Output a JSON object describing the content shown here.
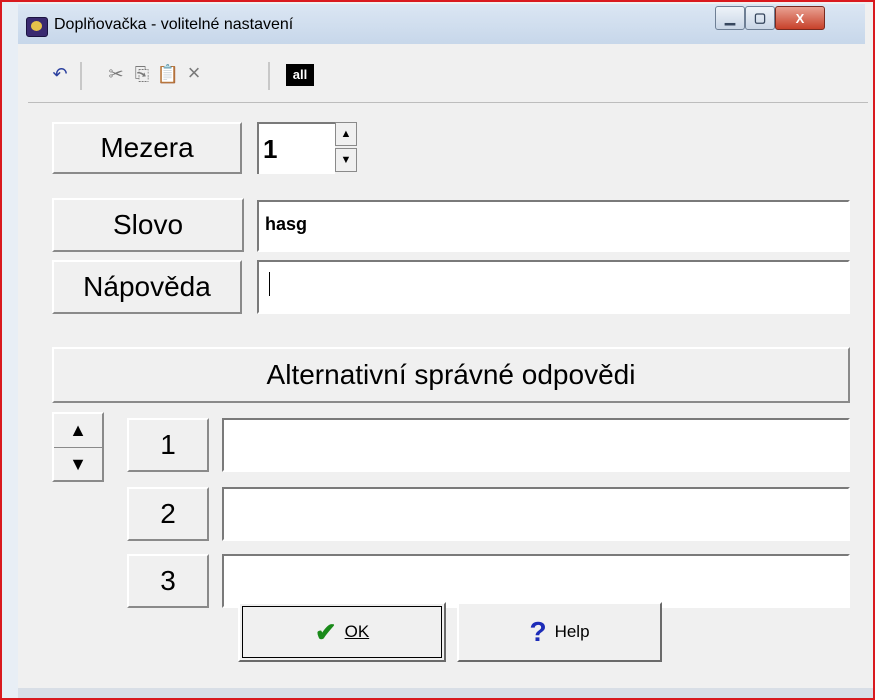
{
  "window": {
    "title": "Doplňovačka - volitelné nastavení",
    "controls": {
      "minimize": "▁",
      "maximize": "▢",
      "close": "X"
    }
  },
  "toolbar": {
    "undo_icon": "↶",
    "cut_icon": "✂",
    "copy_icon": "⎘",
    "paste_icon": "📋",
    "delete_icon": "×",
    "all_label": "all"
  },
  "form": {
    "mezera_label": "Mezera",
    "mezera_value": "1",
    "slovo_label": "Slovo",
    "slovo_value": "hasg",
    "napoveda_label": "Nápověda",
    "napoveda_value": ""
  },
  "alternatives": {
    "header": "Alternativní správné odpovědi",
    "rows": [
      {
        "label": "1",
        "value": ""
      },
      {
        "label": "2",
        "value": ""
      },
      {
        "label": "3",
        "value": ""
      }
    ]
  },
  "buttons": {
    "ok": "OK",
    "help": "Help"
  }
}
